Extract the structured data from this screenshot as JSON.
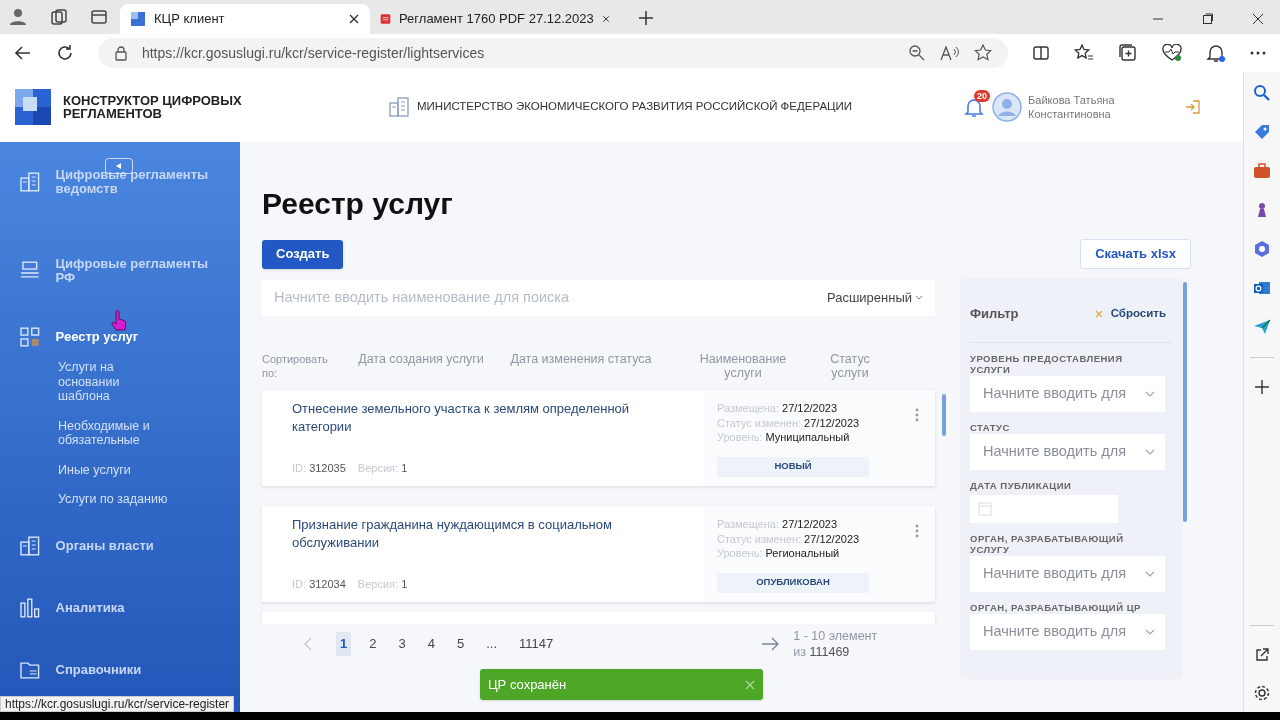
{
  "browser": {
    "tabs": [
      {
        "title": "КЦР клиент",
        "kind": "app",
        "selected": true
      },
      {
        "title": "Регламент 1760 PDF 27.12.2023",
        "kind": "pdf",
        "selected": false
      }
    ],
    "url": "https://kcr.gosuslugi.ru/kcr/service-register/lightservices",
    "status_url": "https://kcr.gosuslugi.ru/kcr/service-register"
  },
  "header": {
    "logo_text": "КОНСТРУКТОР ЦИФРОВЫХ РЕГЛАМЕНТОВ",
    "ministry": "МИНИСТЕРСТВО ЭКОНОМИЧЕСКОГО РАЗВИТИЯ РОССИЙСКОЙ ФЕДЕРАЦИИ",
    "notifications": "20",
    "user_name": [
      "Байкова Татьяна",
      "Константиновна"
    ]
  },
  "sidebar": {
    "items": [
      {
        "label": "Цифровые регламенты ведомств",
        "selected": false
      },
      {
        "label": "Цифровые регламенты РФ",
        "selected": false
      },
      {
        "label": "Реестр услуг",
        "selected": true,
        "children": [
          {
            "label": "Услуги на основании шаблона"
          },
          {
            "label": "Необходимые и обязательные"
          },
          {
            "label": "Иные услуги"
          },
          {
            "label": "Услуги по заданию"
          }
        ]
      },
      {
        "label": "Органы власти",
        "selected": false
      },
      {
        "label": "Аналитика",
        "selected": false
      },
      {
        "label": "Справочники",
        "selected": false
      }
    ]
  },
  "page": {
    "title": "Реестр услуг",
    "create_button": "Создать",
    "download_button": "Скачать xlsx",
    "search": {
      "placeholder": "Начните вводить наименование для поиска",
      "advanced": "Расширенный"
    },
    "sort_label": "Сортировать по:",
    "sort_columns": [
      "Дата создания услуги",
      "Дата изменения статуса",
      "Наименование услуги",
      "Статус услуги"
    ],
    "cards": [
      {
        "title": "Отнесение земельного участка к землям определенной категории",
        "id_label": "ID:",
        "id": "312035",
        "version_label": "Версия:",
        "version": "1",
        "placed_label": "Размещена:",
        "placed": "27/12/2023",
        "changed_label": "Статус изменен:",
        "changed": "27/12/2023",
        "level_label": "Уровень:",
        "level": "Муниципальный",
        "status": "НОВЫЙ"
      },
      {
        "title": "Признание гражданина нуждающимся в социальном обслуживании",
        "id_label": "ID:",
        "id": "312034",
        "version_label": "Версия:",
        "version": "1",
        "placed_label": "Размещена:",
        "placed": "27/12/2023",
        "changed_label": "Статус изменен:",
        "changed": "27/12/2023",
        "level_label": "Уровень:",
        "level": "Региональный",
        "status": "ОПУБЛИКОВАН"
      }
    ],
    "pagination": {
      "pages": [
        {
          "label": "1",
          "selected": true
        },
        {
          "label": "2",
          "selected": false
        },
        {
          "label": "3",
          "selected": false
        },
        {
          "label": "4",
          "selected": false
        },
        {
          "label": "5",
          "selected": false
        },
        {
          "label": "...",
          "selected": false
        },
        {
          "label": "11147",
          "selected": false
        }
      ],
      "range": "1 - 10 элемент",
      "total_label": "из",
      "total": "111469"
    },
    "filter": {
      "title": "Фильтр",
      "reset": "Сбросить",
      "fields": [
        {
          "label": "УРОВЕНЬ ПРЕДОСТАВЛЕНИЯ УСЛУГИ",
          "kind": "select",
          "placeholder": "Начните вводить для"
        },
        {
          "label": "СТАТУС",
          "kind": "select",
          "placeholder": "Начните вводить для"
        },
        {
          "label": "ДАТА ПУБЛИКАЦИИ",
          "kind": "date"
        },
        {
          "label": "ОРГАН, РАЗРАБАТЫВАЮЩИЙ УСЛУГУ",
          "kind": "select",
          "placeholder": "Начните вводить для"
        },
        {
          "label": "ОРГАН, РАЗРАБАТЫВАЮЩИЙ ЦР",
          "kind": "select",
          "placeholder": "Начните вводить для"
        }
      ]
    },
    "toast": {
      "text": "ЦР сохранён"
    }
  }
}
